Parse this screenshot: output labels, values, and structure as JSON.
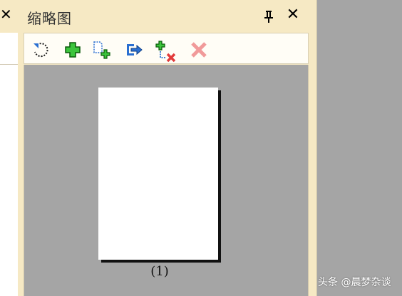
{
  "panel": {
    "title": "缩略图",
    "close_glyph": "✕"
  },
  "left_panel": {
    "close_glyph": "✕"
  },
  "toolbar": {
    "buttons": [
      {
        "icon": "rotate-icon",
        "color": "#2a6fd1"
      },
      {
        "icon": "add-icon",
        "color": "#2fb82f"
      },
      {
        "icon": "insert-page-icon",
        "color": "#2fb82f"
      },
      {
        "icon": "export-icon",
        "color": "#2a6fd1"
      },
      {
        "icon": "replace-page-icon",
        "color": "#e23a3a"
      },
      {
        "icon": "delete-icon",
        "color": "#f19a9a",
        "disabled": true
      }
    ]
  },
  "thumbnails": [
    {
      "label": "(1)"
    }
  ],
  "watermark": "头条 @晨梦杂谈",
  "colors": {
    "panel_bg": "#f6e9c4",
    "thumb_area_bg": "#a5a5a5"
  }
}
